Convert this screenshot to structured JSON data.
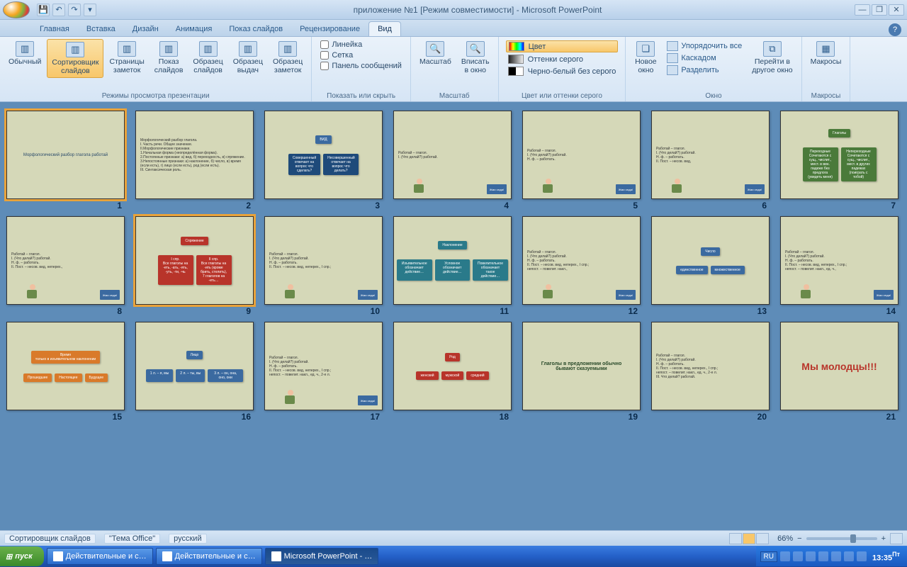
{
  "title": "приложение №1 [Режим совместимости] - Microsoft PowerPoint",
  "qat": {
    "save": "💾",
    "undo": "↶",
    "redo": "↷"
  },
  "tabs": [
    "Главная",
    "Вставка",
    "Дизайн",
    "Анимация",
    "Показ слайдов",
    "Рецензирование",
    "Вид"
  ],
  "active_tab": 6,
  "ribbon": {
    "views": {
      "label": "Режимы просмотра презентации",
      "items": [
        {
          "lbl": "Обычный"
        },
        {
          "lbl": "Сортировщик\nслайдов",
          "active": true
        },
        {
          "lbl": "Страницы\nзаметок"
        },
        {
          "lbl": "Показ\nслайдов"
        },
        {
          "lbl": "Образец\nслайдов"
        },
        {
          "lbl": "Образец\nвыдач"
        },
        {
          "lbl": "Образец\nзаметок"
        }
      ]
    },
    "show_hide": {
      "label": "Показать или скрыть",
      "checks": [
        "Линейка",
        "Сетка",
        "Панель сообщений"
      ]
    },
    "zoom": {
      "label": "Масштаб",
      "items": [
        {
          "lbl": "Масштаб"
        },
        {
          "lbl": "Вписать\nв окно"
        }
      ]
    },
    "color": {
      "label": "Цвет или оттенки серого",
      "items": [
        {
          "lbl": "Цвет",
          "sel": true
        },
        {
          "lbl": "Оттенки серого"
        },
        {
          "lbl": "Черно-белый без серого"
        }
      ]
    },
    "window": {
      "label": "Окно",
      "new_win": "Новое\nокно",
      "small": [
        "Упорядочить все",
        "Каскадом",
        "Разделить"
      ],
      "move": "Перейти в\nдругое окно"
    },
    "macros": {
      "label": "Макросы",
      "btn": "Макросы"
    }
  },
  "slides": [
    {
      "n": 1,
      "sel": true,
      "kind": "title",
      "title": "Морфологический разбор глагола работай"
    },
    {
      "n": 2,
      "kind": "text",
      "lines": "Морфологический разбор глагола.\nI. Часть речи. Общее значение.\nII.Морфологические признаки.\n1.Начальная форма (неопределённая форма).\n2.Постоянные признаки: а) вид, б) переходность, в) спряжение.\n3.Непостоянные признаки: а) наклонение, б) число, в) время (если есть), г) лицо (если есть), род (если есть).\nIII. Синтаксическая роль."
    },
    {
      "n": 3,
      "kind": "diagram-blue",
      "top": "ВИД",
      "boxes": [
        "Совершенный\nотвечает на\nвопрос что\nсделать?",
        "Несовершенный\nотвечает на\nвопрос что\nделать?"
      ]
    },
    {
      "n": 4,
      "kind": "item",
      "text": "Работай – глагол.\nI. (Что делай?) работай.",
      "btn": "Жми\nсюда!"
    },
    {
      "n": 5,
      "kind": "item",
      "text": "Работай – глагол.\nI. (Что делай?) работай.\nН. ф. – работать.",
      "btn": "Жми сюда!"
    },
    {
      "n": 6,
      "kind": "item",
      "text": "Работай – глагол.\nI. (Что делай?) работай.\nН. ф. – работать.\nII. Пост. – несов. вид,",
      "btn": "Жми сюда!"
    },
    {
      "n": 7,
      "kind": "green-tree",
      "top": "Глаголы",
      "boxes": [
        "Переходные\nСочетаются с сущ., числит., мест. в вин. падеже без предлога (увидеть меня)",
        "Непереходные\nСочетаются с сущ., числит., мест. в других падежах (поиграть с тобой)"
      ]
    },
    {
      "n": 8,
      "kind": "item",
      "text": "Работай – глагол.\nI. (Что делай?) работай.\nН. ф. – работать.\nII. Пост. – несов. вид, неперех.,",
      "btn": "Жми сюда!"
    },
    {
      "n": 9,
      "sel": true,
      "kind": "red-tree",
      "top": "Спряжение",
      "boxes": [
        "I спр.\nВсе глаголы на -еть, -ать, -ять, -уть, -ти, -чь",
        "II спр.\nВсе глаголы на -ить (кроме брить, стелить), 7 глаголов на -еть…"
      ]
    },
    {
      "n": 10,
      "kind": "item",
      "text": "Работай – глагол.\nI. (Что делай?) работай.\nН. ф. – работать.\nII. Пост. – несов. вид, неперех., I спр.;",
      "btn": "Жми сюда!"
    },
    {
      "n": 11,
      "kind": "teal-tree",
      "top": "Наклонение",
      "boxes": [
        "Изъявительное\nобозначает действие…",
        "Условное\nобозначает действие…",
        "Повелительное\nобозначает такое действие…"
      ]
    },
    {
      "n": 12,
      "kind": "item",
      "text": "Работай – глагол.\nI. (Что делай?) работай.\nН. ф. – работать.\nII. Пост. – несов. вид, неперех., I спр.;\nнепост. – повелит. накл.,",
      "btn": "Жми сюда!"
    },
    {
      "n": 13,
      "kind": "blue-tree",
      "top": "Число",
      "boxes": [
        "единственное",
        "множественное"
      ]
    },
    {
      "n": 14,
      "kind": "item",
      "text": "Работай – глагол.\nI. (Что делай?) работай.\nН. ф. – работать.\nII. Пост. – несов. вид, неперех., I спр.;\nнепост. – повелит. накл., ед. ч.,",
      "btn": "Жми сюда!"
    },
    {
      "n": 15,
      "kind": "orange-tree",
      "top": "Время\nтолько в изъявительном наклонении",
      "boxes": [
        "Прошедшее",
        "Настоящее",
        "Будущее"
      ]
    },
    {
      "n": 16,
      "kind": "blue-tree",
      "top": "Лицо",
      "boxes": [
        "1 л. – я, мы",
        "2 л. – ты, вы",
        "3 л. – он, она, оно, они"
      ]
    },
    {
      "n": 17,
      "kind": "item",
      "text": "Работай – глагол.\nI. (Что делай?) работай.\nН. ф. – работать.\nII. Пост. – несов. вид, неперех., I спр.;\nнепост. – повелит. накл., ед. ч., 2-е л.",
      "btn": "Жми сюда!"
    },
    {
      "n": 18,
      "kind": "red-tree",
      "top": "Род",
      "boxes": [
        "женский",
        "мужской",
        "средний"
      ]
    },
    {
      "n": 19,
      "kind": "center",
      "title": "Глаголы в предложении обычно бывают сказуемыми"
    },
    {
      "n": 20,
      "kind": "text",
      "lines": "Работай – глагол.\nI. (Что делай?) работай.\nН. ф. – работать.\nII. Пост. – несов. вид, неперех., I спр.;\nнепост. – повелит. накл., ед. ч., 2-е л.\nIII. Что делай? работай."
    },
    {
      "n": 21,
      "kind": "big-red",
      "title": "Мы молодцы!!!"
    }
  ],
  "status": {
    "view": "Сортировщик слайдов",
    "theme": "\"Тема Office\"",
    "lang": "русский",
    "zoom": "66%"
  },
  "taskbar": {
    "start": "пуск",
    "tasks": [
      "Действительные и с…",
      "Действительные и с…",
      "Microsoft PowerPoint - …"
    ],
    "ru": "RU",
    "clock": "13:35",
    "day": "Пт"
  }
}
